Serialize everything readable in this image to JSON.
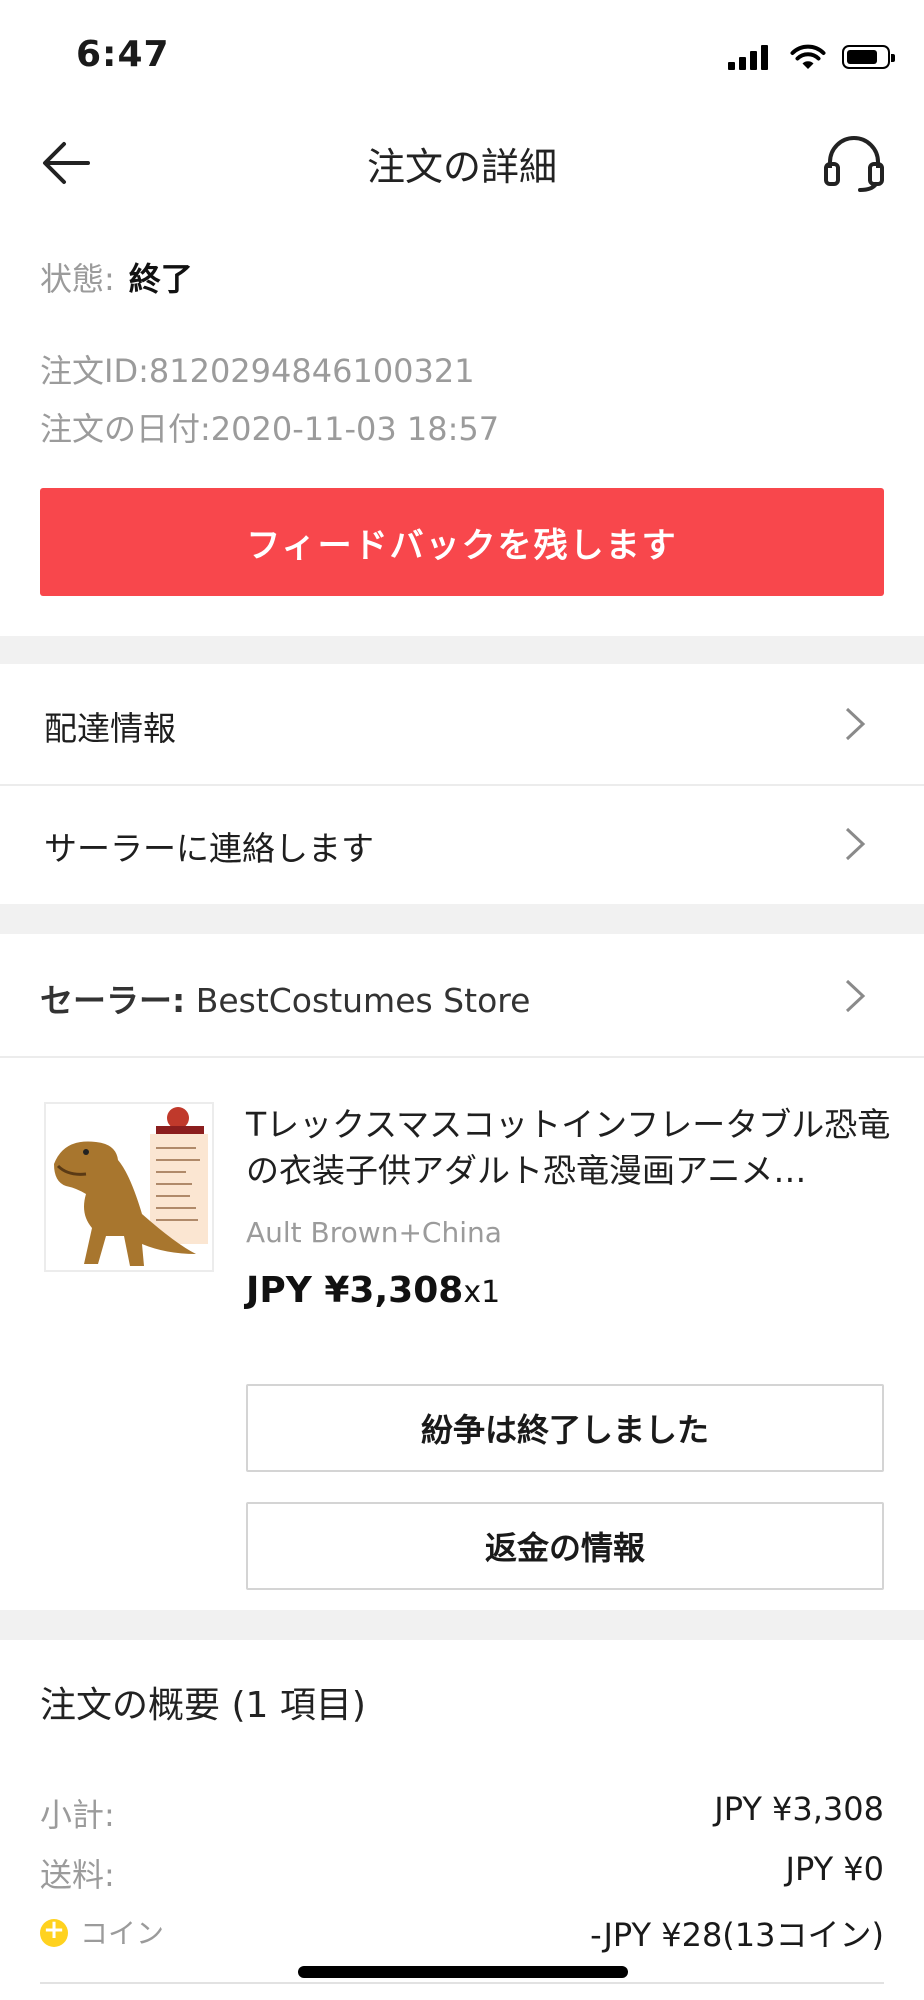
{
  "status_bar": {
    "time": "6:47"
  },
  "header": {
    "title": "注文の詳細",
    "back_icon": "arrow-left-icon",
    "support_icon": "headset-icon"
  },
  "order": {
    "status_label": "状態:",
    "status_value": "終了",
    "order_id": "注文ID:8120294846100321",
    "order_date": "注文の日付:2020-11-03 18:57"
  },
  "feedback_button": "フィードバックを残します",
  "links": {
    "delivery_info": "配達情報",
    "contact_seller": "サーラーに連絡します"
  },
  "seller": {
    "label": "セーラー:",
    "name": " BestCostumes Store"
  },
  "product": {
    "title": "Tレックスマスコットインフレータブル恐竜の衣装子供アダルト恐竜漫画アニメ…",
    "variant": "Ault Brown+China",
    "price": "JPY ¥3,308",
    "quantity": "x1"
  },
  "actions": {
    "dispute_closed": "紛争は終了しました",
    "refund_info": "返金の情報"
  },
  "summary": {
    "title": "注文の概要 (1 項目)",
    "rows": [
      {
        "label": "小計:",
        "value": "JPY ¥3,308"
      },
      {
        "label": "送料:",
        "value": "JPY ¥0"
      },
      {
        "label": "コイン",
        "value": "-JPY ¥28(13コイン)"
      }
    ]
  },
  "colors": {
    "accent": "#f8474c",
    "coin": "#ffd21f",
    "muted": "#9b9b9b",
    "gap": "#f1f1f1"
  }
}
